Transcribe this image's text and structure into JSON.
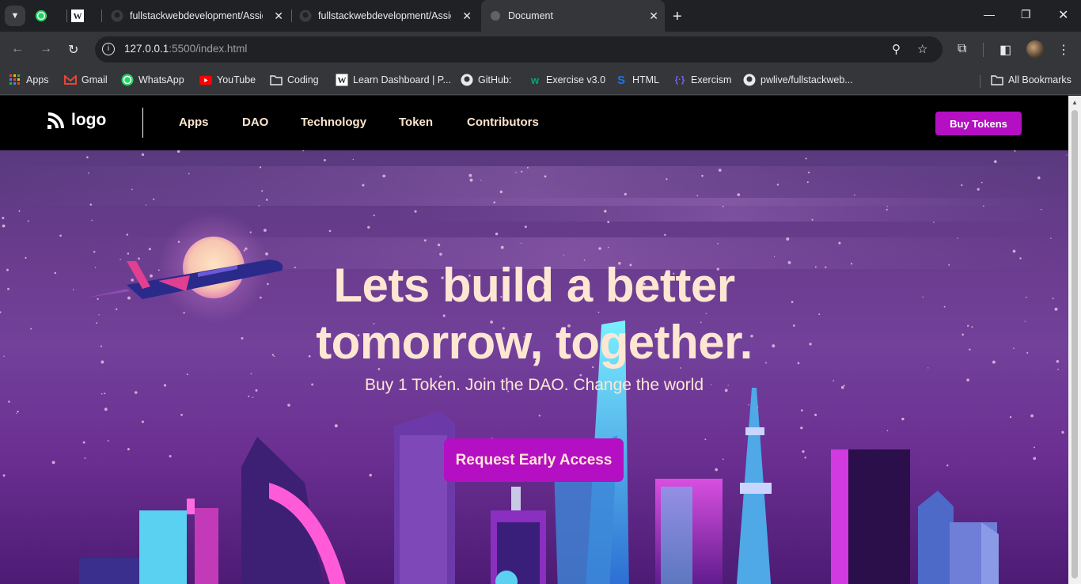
{
  "browser": {
    "tabs": [
      {
        "title": "",
        "icon": "whatsapp-icon"
      },
      {
        "title": "",
        "icon": "wordpress-icon"
      },
      {
        "title": "fullstackwebdevelopment/Assig",
        "icon": "github-icon"
      },
      {
        "title": "fullstackwebdevelopment/Assig",
        "icon": "github-icon"
      },
      {
        "title": "Document",
        "icon": "globe-icon"
      }
    ],
    "url_host": "127.0.0.1",
    "url_rest": ":5500/index.html",
    "bookmarks": [
      {
        "label": "Apps",
        "icon": "apps-grid-icon"
      },
      {
        "label": "Gmail",
        "icon": "gmail-icon"
      },
      {
        "label": "WhatsApp",
        "icon": "whatsapp-icon"
      },
      {
        "label": "YouTube",
        "icon": "youtube-icon"
      },
      {
        "label": "Coding",
        "icon": "folder-icon"
      },
      {
        "label": "Learn Dashboard | P...",
        "icon": "wordpress-icon"
      },
      {
        "label": "GitHub:",
        "icon": "github-icon"
      },
      {
        "label": "Exercise v3.0",
        "icon": "exercise-icon"
      },
      {
        "label": "HTML",
        "icon": "html-s-icon"
      },
      {
        "label": "Exercism",
        "icon": "exercism-icon"
      },
      {
        "label": "pwlive/fullstackweb...",
        "icon": "github-icon"
      }
    ],
    "all_bookmarks": "All Bookmarks"
  },
  "site": {
    "logo_text": "logo",
    "nav": [
      "Apps",
      "DAO",
      "Technology",
      "Token",
      "Contributors"
    ],
    "buy_button": "Buy Tokens",
    "hero": {
      "headline_line1": "Lets build a better",
      "headline_line2": "tomorrow, together.",
      "subheadline": "Buy 1 Token. Join the DAO. Change the world",
      "cta": "Request Early Access"
    }
  },
  "colors": {
    "accent": "#b40fc3",
    "headline": "#fde7d3",
    "nav_text": "#ffe6cf"
  }
}
